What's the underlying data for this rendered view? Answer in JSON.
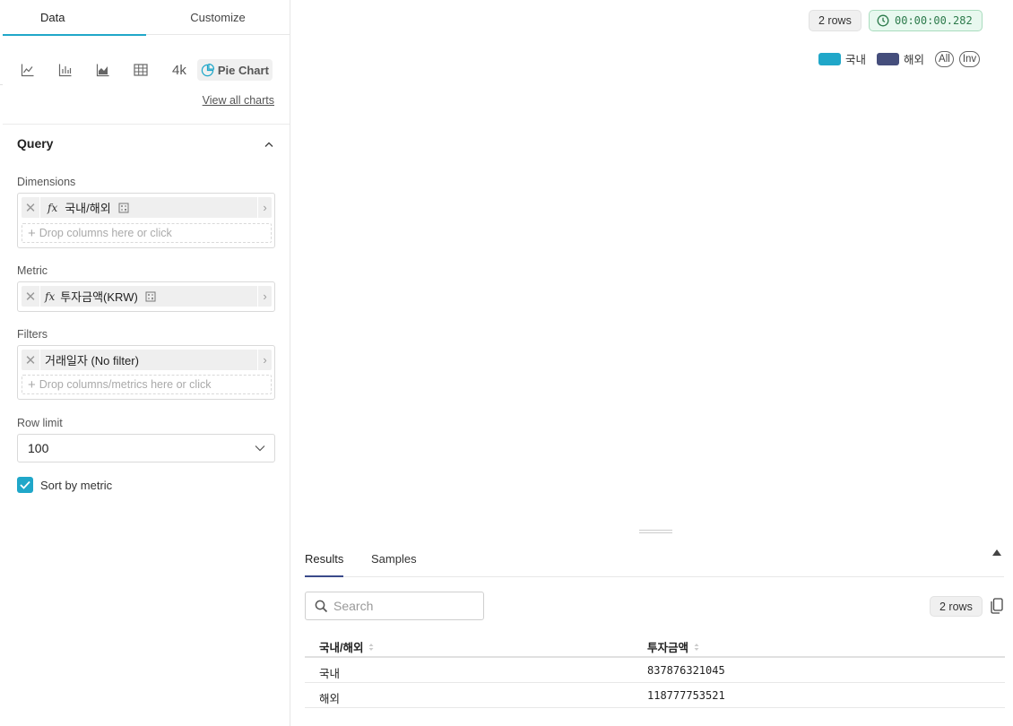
{
  "tabs": {
    "data": "Data",
    "customize": "Customize"
  },
  "chart_types": {
    "four_k": "4k",
    "pie": "Pie Chart",
    "view_all": "View all charts"
  },
  "query": {
    "title": "Query",
    "dimensions_label": "Dimensions",
    "dimension_pill": "국내/해외",
    "dimension_drop": "Drop columns here or click",
    "metric_label": "Metric",
    "metric_pill": "투자금액(KRW)",
    "filters_label": "Filters",
    "filter_pill": "거래일자 (No filter)",
    "filter_drop": "Drop columns/metrics here or click",
    "row_limit_label": "Row limit",
    "row_limit_value": "100",
    "sort_by_metric": "Sort by metric",
    "fx": "fx"
  },
  "header": {
    "rows": "2 rows",
    "timer": "00:00:00.282"
  },
  "legend": {
    "items": [
      {
        "label": "국내",
        "color": "#20a7c9"
      },
      {
        "label": "해외",
        "color": "#454e7c"
      }
    ],
    "all": "All",
    "inv": "Inv"
  },
  "results": {
    "tab_results": "Results",
    "tab_samples": "Samples",
    "search_placeholder": "Search",
    "rows": "2 rows",
    "columns": [
      "국내/해외",
      "투자금액"
    ],
    "rows_data": [
      [
        "국내",
        "837876321045"
      ],
      [
        "해외",
        "118777753521"
      ]
    ]
  },
  "colors": {
    "accent": "#20a7c9",
    "timer_green": "#2c7a4b"
  }
}
